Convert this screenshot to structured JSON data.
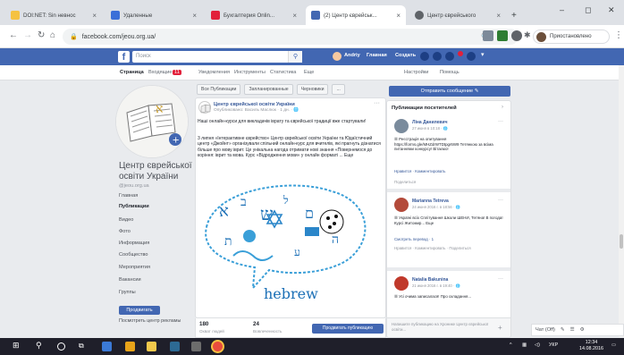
{
  "browser": {
    "tabs": [
      {
        "title": "DOI:NET: Sin невнос",
        "color": "#f5c242",
        "active": false
      },
      {
        "title": "Удаленные",
        "color": "#3b6fd8",
        "active": false
      },
      {
        "title": "Бухгалтерия Onlin...",
        "color": "#e2203a",
        "active": false
      },
      {
        "title": "(2) Центр єврейськ...",
        "color": "#4267b2",
        "active": true
      },
      {
        "title": "Центр єврейського",
        "color": "#5f6368",
        "active": false
      }
    ],
    "url": "facebook.com/jeou.org.ua/",
    "profile_label": "Приостановлено",
    "window_controls": {
      "minimize": "–",
      "maximize": "◻",
      "close": "✕"
    }
  },
  "facebook": {
    "logo": "f",
    "search_placeholder": "Поиск",
    "nav": {
      "profile": "Andriy",
      "home": "Главная",
      "create": "Создать"
    },
    "page_nav": [
      "Страница",
      "Входящие",
      "Уведомления",
      "Инструменты",
      "Статистика",
      "Еще",
      "Настройки",
      "Помощь"
    ],
    "page_nav_badge": "11"
  },
  "page": {
    "name": "Центр єврейської освіти України",
    "handle": "@jeou.org.ua",
    "left_nav": [
      "Главная",
      "Публикации",
      "Видео",
      "Фото",
      "Информация",
      "Сообщество",
      "Мероприятия",
      "Вакансии",
      "Группы"
    ],
    "left_nav_active": 1,
    "promote_label": "Продвигать",
    "view_ads_label": "Посмотреть центр рекламы"
  },
  "feed": {
    "tabs": [
      "Все Публикации",
      "Запланированные",
      "Черновики",
      "..."
    ],
    "post": {
      "author": "Центр єврейської освіти України",
      "meta": "Опубликовано: Василь Маслюк · 1 дн. · 🌐",
      "intro": "Наші онлайн-курси для викладачів іврату та єврейської традиції вже стартували!",
      "body": "3 липня «Інтерактивне єврейство» Центр єврейської освіти України та Юдаїстичний центр «Джойнт» організували спільний онлайн-курс для вчителів, які прагнуть дізнатися більше про мову іврит. Це унікальна нагода отримати нові знання «Повернемося до коріння: іврит та мова. Курс «Відродження мови» у онлайн форматі ... Еще",
      "image_caption": "hebrew"
    },
    "stats": {
      "reach": "180",
      "reach_label": "Охват людей",
      "engagement": "24",
      "engagement_label": "Вовлеченность",
      "boost_label": "Продвигать публикацию"
    }
  },
  "right": {
    "send_message": "Отправить сообщение ✎",
    "visitor_title": "Публикации посетителей",
    "visitor_posts": [
      {
        "name": "Ліна Данилевич",
        "date": "27 июня в 10:18 · 🌐",
        "text": "☰ Реєстрація на опитування https://forms.gle/MHZdrWTDtpgr6W9 Тетянкою за всіма питаннями конкурсу! Вітаємо!",
        "link": "Нравится · Комментировать",
        "actions": "Поделиться"
      },
      {
        "name": "Marianna Tetreva",
        "date": "24 июня 2016 г. в 18:56 · 🌐",
        "text": "☰ Україні всіх Сплітування Школи ШЕНИ, Тетяна! В погода! Курсі Житомир... Еще",
        "link": "Смотреть перевод · 1",
        "actions": "Нравится · Комментировать · Поделиться"
      },
      {
        "name": "Natalia Bakunina",
        "date": "21 июня 2016 г. в 19:40 · 🌐",
        "text": "☰ Усі очима записалася! Про складання...",
        "link": "",
        "actions": ""
      }
    ],
    "comment_placeholder": "Напишите публикацию на Хронике Центр єврейської освіти..."
  },
  "chat": {
    "label": "Чат (Off)"
  },
  "taskbar": {
    "lang": "УКР",
    "time": "12:34",
    "date": "14.08.2016"
  },
  "colors": {
    "fb_blue": "#4267b2",
    "link": "#365899",
    "bg": "#e9ebee"
  }
}
